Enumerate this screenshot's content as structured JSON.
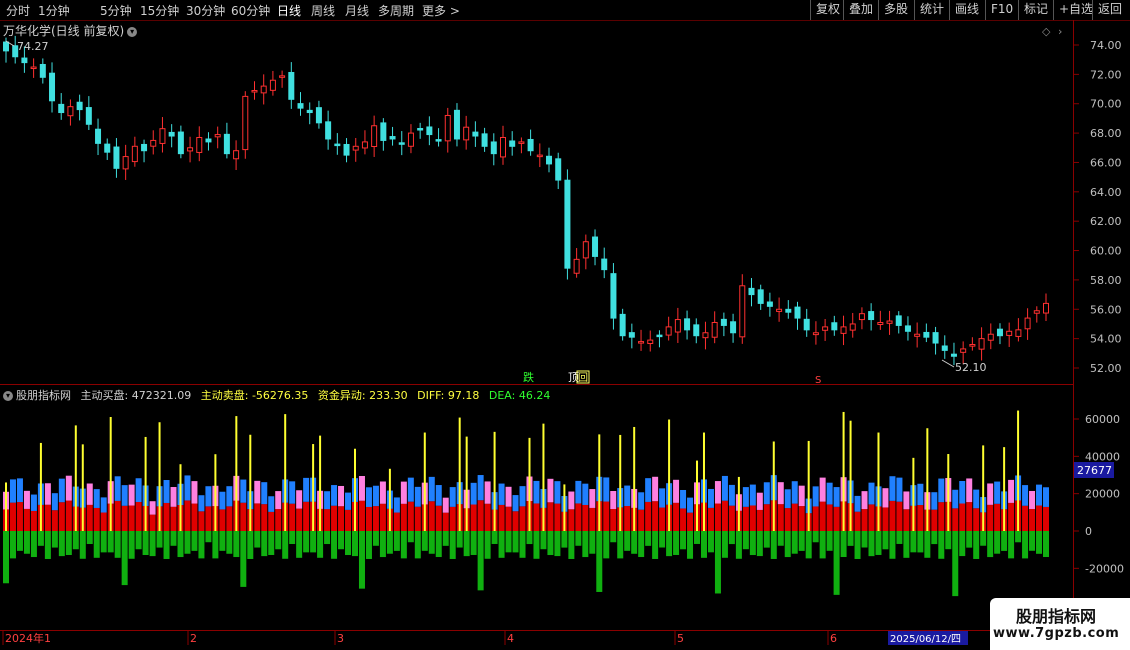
{
  "toolbar": {
    "periods": [
      "分时",
      "1分钟",
      "5分钟",
      "15分钟",
      "30分钟",
      "60分钟",
      "日线",
      "周线",
      "月线",
      "多周期",
      "更多 >"
    ],
    "active_period": "日线",
    "right_buttons": [
      "复权",
      "叠加",
      "多股",
      "统计",
      "画线",
      "F10",
      "标记",
      "+自选",
      "返回"
    ]
  },
  "main_chart": {
    "title": "万华化学(日线 前复权)",
    "max_label": "74.27",
    "min_label": "52.10",
    "price_axis": [
      "74.00",
      "72.00",
      "70.00",
      "68.00",
      "66.00",
      "64.00",
      "62.00",
      "60.00",
      "58.00",
      "56.00",
      "54.00",
      "52.00"
    ],
    "markers": [
      {
        "text": "跌",
        "color": "#30ff30"
      },
      {
        "text": "顶",
        "color": "#ffffff"
      },
      {
        "text": "回",
        "color": "#ffff60"
      },
      {
        "text": "S",
        "color": "#ff4040"
      }
    ]
  },
  "indicator": {
    "name": "股朋指标网",
    "fields": [
      {
        "label": "主动买盘:",
        "value": "472321.09",
        "color": "#d0d0d0"
      },
      {
        "label": "主动卖盘:",
        "value": "-56276.35",
        "color": "#ffff40"
      },
      {
        "label": "资金异动:",
        "value": "233.30",
        "color": "#ffff40"
      },
      {
        "label": "DIFF:",
        "value": "97.18",
        "color": "#ffff40"
      },
      {
        "label": "DEA:",
        "value": "46.24",
        "color": "#30ff30"
      }
    ],
    "axis": [
      "60000",
      "40000",
      "20000",
      "0",
      "-20000"
    ],
    "current_value": "27677"
  },
  "timeline": {
    "labels": [
      "2024年1",
      "2",
      "3",
      "4",
      "5",
      "6"
    ],
    "date_badge": "2025/06/12/四"
  },
  "watermark": {
    "line1": "股朋指标网",
    "line2": "www.7gpzb.com"
  },
  "colors": {
    "up": "#ff3030",
    "down": "#40e0e0",
    "grid": "#3a0000",
    "axis_text": "#c0c0c0"
  }
}
